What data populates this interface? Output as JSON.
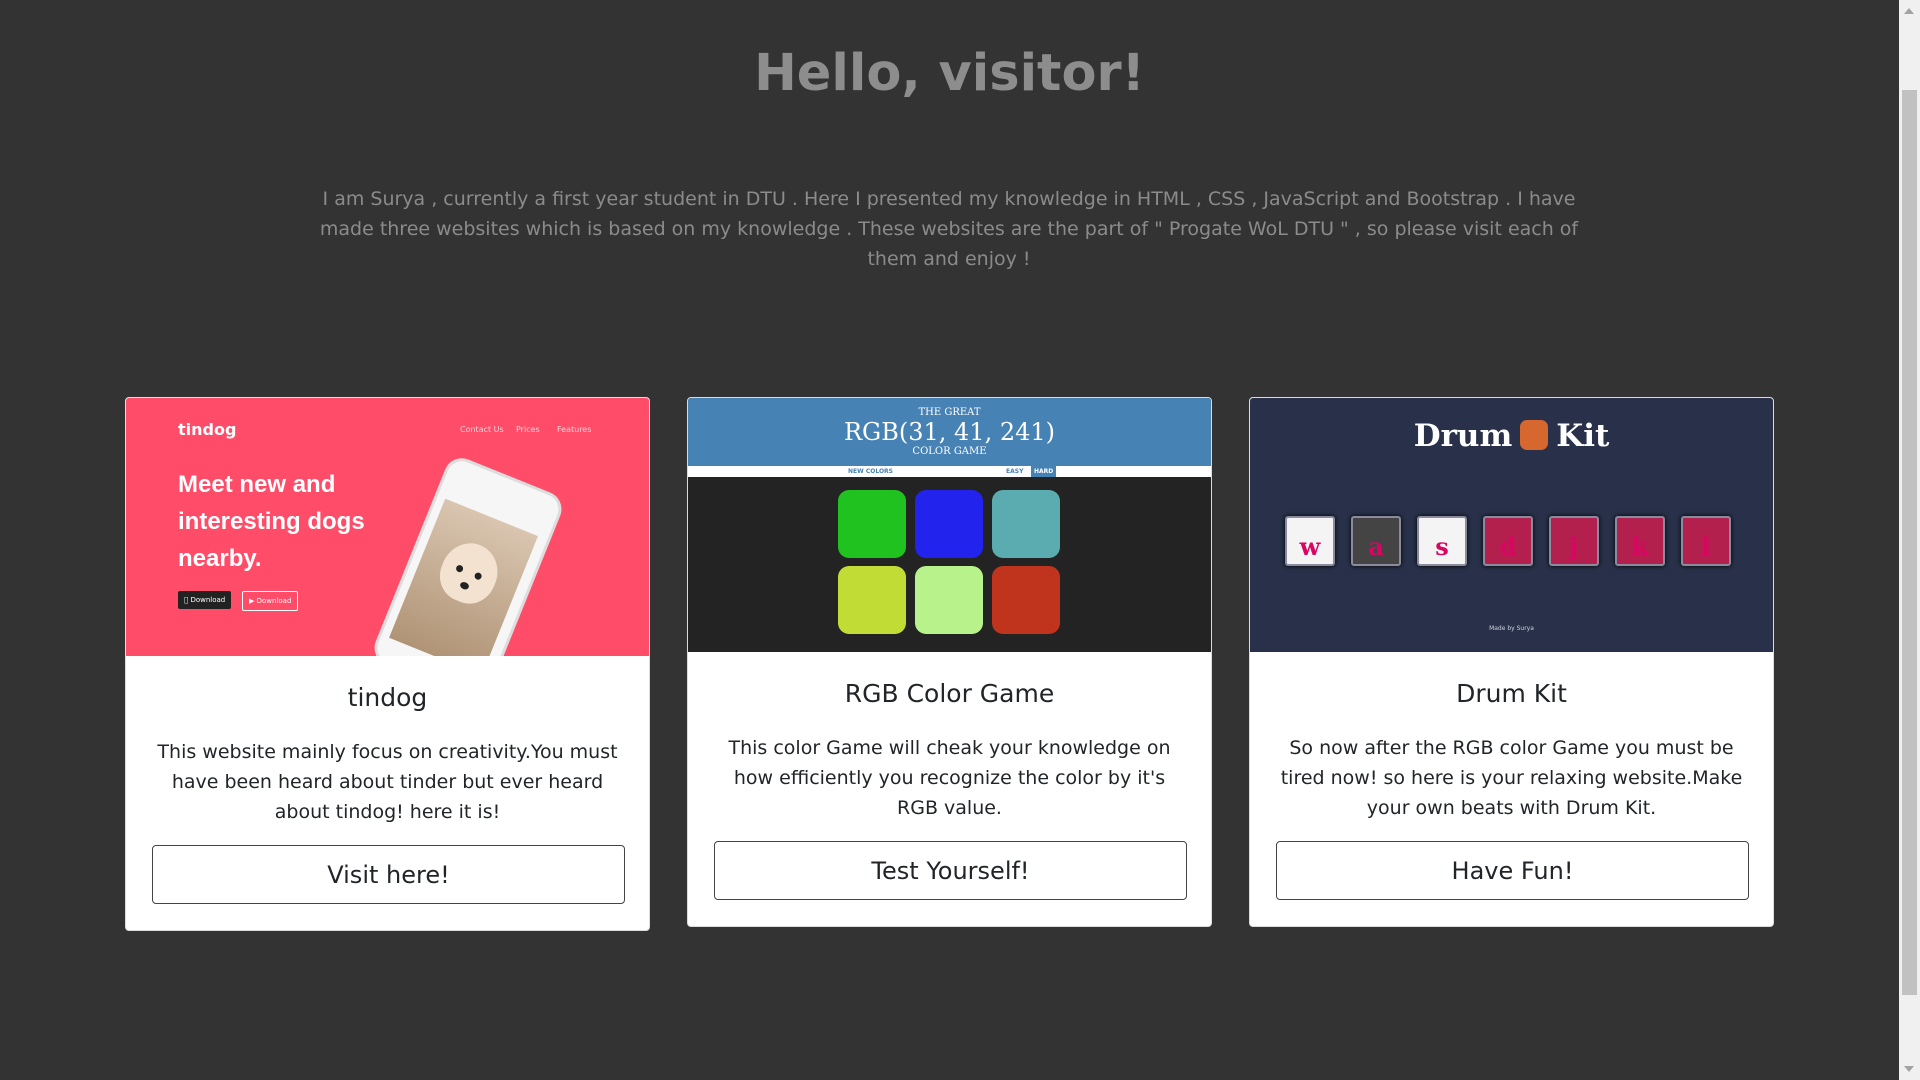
{
  "greeting": "Hello, visitor!",
  "intro": "I am Surya , currently a first year student in DTU . Here I presented my knowledge in HTML , CSS , JavaScript and Bootstrap . I have made three websites which is based on my knowledge . These websites are the part of \" Progate WoL DTU \" , so please visit each of them and enjoy !",
  "colors": {
    "page_background": "#333333",
    "tindog_pink": "#ff4c68",
    "rgb_header_blue": "#4682b4",
    "drum_navy": "#283149"
  },
  "cards": [
    {
      "title": "tindog",
      "text": "This website mainly focus on creativity.You must have been heard about tinder but ever heard about tindog! here it is!",
      "button": "Visit here!",
      "preview": {
        "logo": "tindog",
        "nav": [
          "Contact Us",
          "Prices",
          "Features"
        ],
        "headline": "Meet new and interesting dogs nearby.",
        "download_buttons": [
          "Download",
          "Download"
        ]
      }
    },
    {
      "title": "RGB Color Game",
      "text": "This color Game will cheak your knowledge on how efficiently you recognize the color by it's RGB value.",
      "button": "Test Yourself!",
      "preview": {
        "line1": "THE GREAT",
        "rgb": "RGB(31, 41, 241)",
        "line3": "COLOR GAME",
        "new_colors": "NEW COLORS",
        "easy": "EASY",
        "hard": "HARD",
        "squares": [
          "#1fc21f",
          "#2323ee",
          "#5aacb0",
          "#c1dc35",
          "#b8f28a",
          "#c0331d"
        ]
      }
    },
    {
      "title": "Drum Kit",
      "text": "So now after the RGB color Game you must be tired now! so here is your relaxing website.Make your own beats with Drum Kit.",
      "button": "Have Fun!",
      "preview": {
        "title_left": "Drum",
        "title_right": "Kit",
        "keys": [
          "w",
          "a",
          "s",
          "d",
          "j",
          "k",
          "l"
        ],
        "credit": "Made by Surya"
      }
    }
  ]
}
